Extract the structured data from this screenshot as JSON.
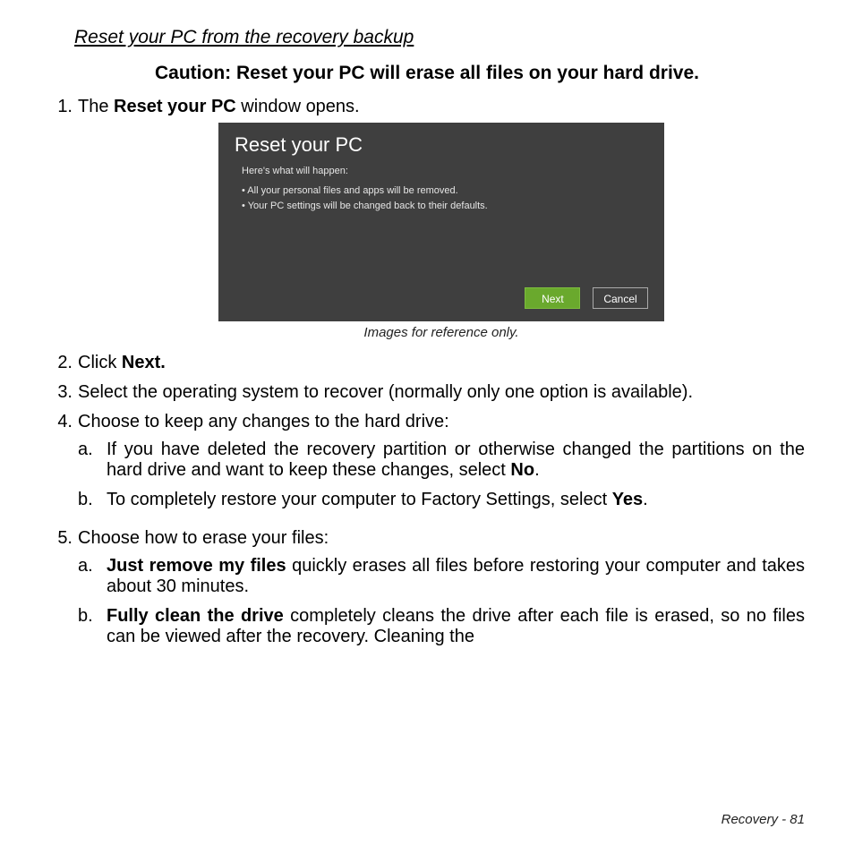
{
  "heading": "Reset your PC from the recovery backup",
  "caution": "Caution: Reset your PC will erase all files on your hard drive.",
  "steps": {
    "s1_a": "The ",
    "s1_b": "Reset your PC",
    "s1_c": " window opens.",
    "s2_a": "Click ",
    "s2_b": "Next.",
    "s3": "Select the operating system to recover (normally only one option is available).",
    "s4": "Choose to keep any changes to the hard drive:",
    "s4a_a": "If you have deleted the recovery partition or otherwise changed the partitions on the hard drive and want to keep these changes, select ",
    "s4a_b": "No",
    "s4a_c": ".",
    "s4b_a": "To completely restore your computer to Factory Settings, select ",
    "s4b_b": "Yes",
    "s4b_c": ".",
    "s5": "Choose how to erase your files:",
    "s5a_a": "Just remove my files",
    "s5a_b": " quickly erases all files before restoring your computer and takes about 30 minutes.",
    "s5b_a": "Fully clean the drive",
    "s5b_b": " completely cleans the drive after each file is erased, so no files can be viewed after the recovery. Cleaning the"
  },
  "shot": {
    "title": "Reset your PC",
    "subtitle": "Here's what will happen:",
    "b1": "• All your personal files and apps will be removed.",
    "b2": "• Your PC settings will be changed back to their defaults.",
    "next": "Next",
    "cancel": "Cancel",
    "caption": "Images for reference only."
  },
  "footer": "Recovery -  81"
}
